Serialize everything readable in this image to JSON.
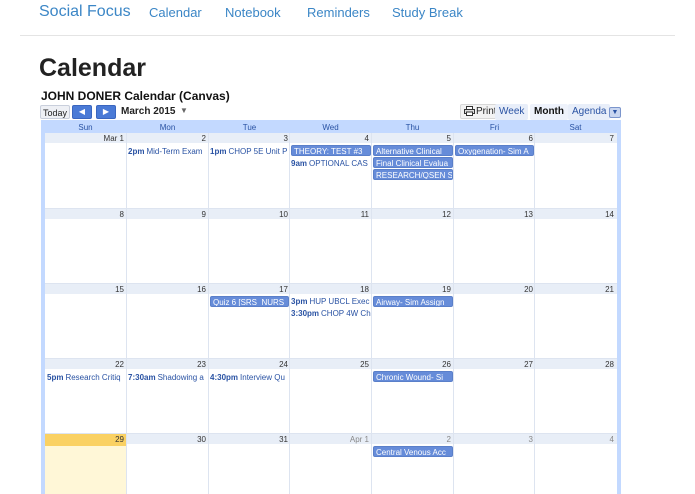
{
  "nav": {
    "brand": "Social Focus",
    "links": [
      "Calendar",
      "Notebook",
      "Reminders",
      "Study Break"
    ]
  },
  "page": {
    "title": "Calendar"
  },
  "calendar": {
    "title": "JOHN DONER Calendar (Canvas)",
    "today_label": "Today",
    "prev_icon": "chevron-left-icon",
    "next_icon": "chevron-right-icon",
    "month_label": "March 2015",
    "print_label": "Print",
    "views": [
      "Week",
      "Month",
      "Agenda"
    ],
    "active_view": "Month",
    "days": [
      "Sun",
      "Mon",
      "Tue",
      "Wed",
      "Thu",
      "Fri",
      "Sat"
    ],
    "weeks": [
      [
        "Mar 1",
        "2",
        "3",
        "4",
        "5",
        "6",
        "7"
      ],
      [
        "8",
        "9",
        "10",
        "11",
        "12",
        "13",
        "14"
      ],
      [
        "15",
        "16",
        "17",
        "18",
        "19",
        "20",
        "21"
      ],
      [
        "22",
        "23",
        "24",
        "25",
        "26",
        "27",
        "28"
      ],
      [
        "29",
        "30",
        "31",
        "Apr 1",
        "2",
        "3",
        "4"
      ]
    ],
    "events": [
      {
        "time": "2pm",
        "title": "Mid-Term Exam"
      },
      {
        "time": "1pm",
        "title": "CHOP 5E Unit P"
      },
      {
        "time": "",
        "title": "THEORY: TEST #3"
      },
      {
        "time": "9am",
        "title": "OPTIONAL CAS"
      },
      {
        "time": "",
        "title": "Alternative Clinical"
      },
      {
        "time": "",
        "title": "Final Clinical Evalua"
      },
      {
        "time": "",
        "title": "RESEARCH/QSEN S"
      },
      {
        "time": "",
        "title": "Oxygenation- Sim A"
      },
      {
        "time": "",
        "title": "Quiz 6 [SRS_NURS"
      },
      {
        "time": "3pm",
        "title": "HUP UBCL Exec"
      },
      {
        "time": "3:30pm",
        "title": "CHOP 4W Ch"
      },
      {
        "time": "",
        "title": "Airway- Sim Assign"
      },
      {
        "time": "5pm",
        "title": "Research Critiq"
      },
      {
        "time": "7:30am",
        "title": "Shadowing a"
      },
      {
        "time": "4:30pm",
        "title": "Interview Qu"
      },
      {
        "time": "",
        "title": "Chronic Wound- Si"
      },
      {
        "time": "",
        "title": "Central Venous Acc"
      }
    ]
  },
  "colors": {
    "link": "#3b86c6",
    "calendar_frame": "#c3d9ff",
    "event_chip": "#668cd9",
    "event_text": "#2952a3",
    "today_highlight": "#fad163"
  }
}
